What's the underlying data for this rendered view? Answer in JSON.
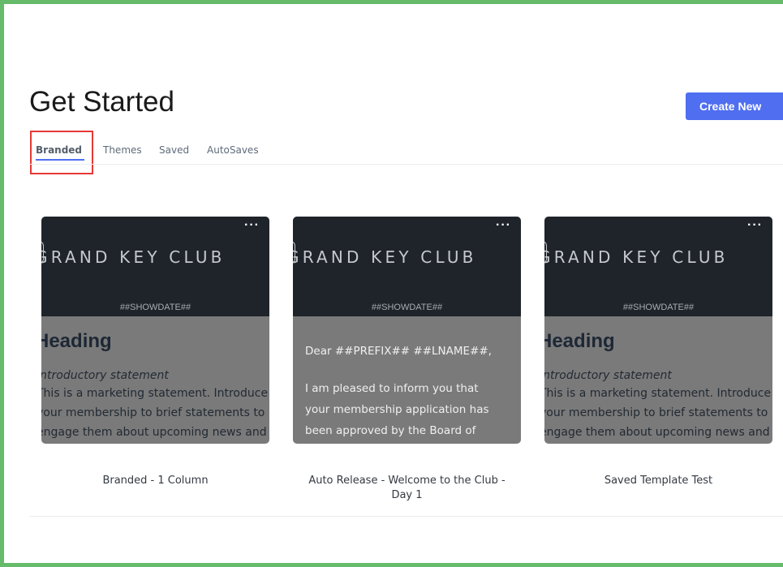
{
  "page": {
    "title": "Get Started",
    "create_button": "Create New"
  },
  "tabs": [
    {
      "label": "Branded",
      "active": true
    },
    {
      "label": "Themes",
      "active": false
    },
    {
      "label": "Saved",
      "active": false
    },
    {
      "label": "AutoSaves",
      "active": false
    }
  ],
  "cards": [
    {
      "label": "Branded - 1 Column",
      "more_icon": "···",
      "brand": "GRAND KEY CLUB",
      "showdate": "##SHOWDATE##",
      "heading": "Heading",
      "intro": "Introductory statement",
      "lines": [
        "This is a marketing statement. Introduce",
        "your membership to brief statements to",
        "engage them about upcoming news and"
      ]
    },
    {
      "label_line1": "Auto Release - Welcome to the Club -",
      "label_line2": "Day 1",
      "more_icon": "···",
      "brand": "GRAND KEY CLUB",
      "showdate": "##SHOWDATE##",
      "greeting": "Dear ##PREFIX## ##LNAME##,",
      "lines": [
        "I am pleased to inform you that",
        "your membership application has",
        "been approved by the Board of"
      ]
    },
    {
      "label": "Saved Template Test",
      "more_icon": "···",
      "brand": "GRAND KEY CLUB",
      "showdate": "##SHOWDATE##",
      "heading": "Heading",
      "intro": "Introductory statement",
      "lines": [
        "This is a marketing statement. Introduce",
        "your membership to brief statements to",
        "engage them about upcoming news and"
      ]
    }
  ],
  "colors": {
    "accent": "#4f6ef0",
    "highlight": "#e53935",
    "frame": "#66bb6a",
    "card_header": "#1f242b",
    "card_body": "#7a7a7a"
  }
}
